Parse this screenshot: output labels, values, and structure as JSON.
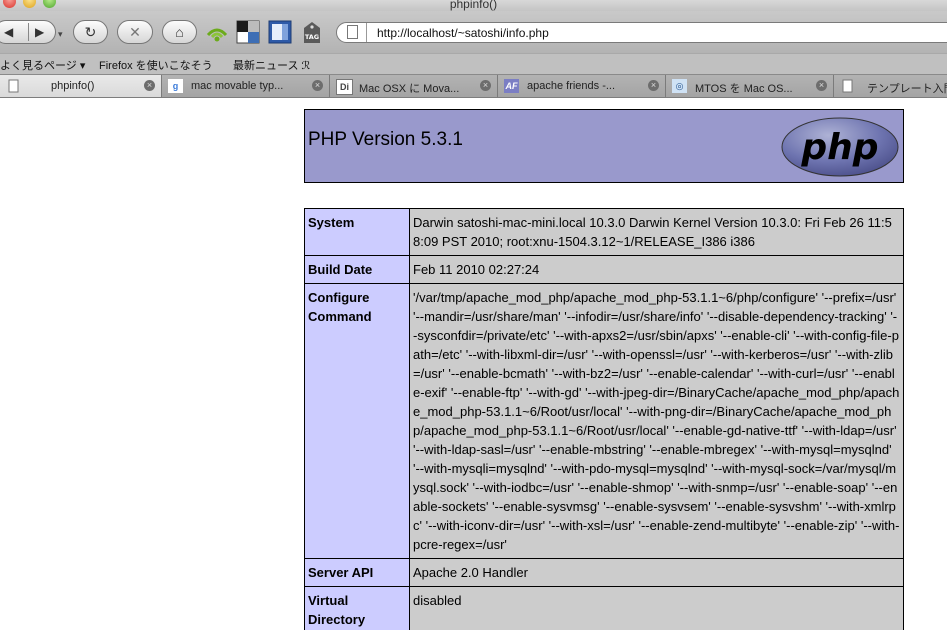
{
  "window": {
    "title": "phpinfo()"
  },
  "toolbar": {
    "back_icon": "back-arrow-icon",
    "forward_icon": "forward-arrow-icon",
    "reload_icon": "reload-icon",
    "stop_icon": "stop-icon",
    "home_icon": "home-icon",
    "url": "http://localhost/~satoshi/info.php"
  },
  "bookmarks": [
    {
      "label": "よく見るページ ▾"
    },
    {
      "label": "Firefox を使いこなそう"
    },
    {
      "label": "最新ニュース ℛ"
    }
  ],
  "tabs": [
    {
      "label": "phpinfo()",
      "active": true
    },
    {
      "label": "mac movable typ...",
      "active": false
    },
    {
      "label": "Mac OSX に Mova...",
      "active": false
    },
    {
      "label": "apache friends -...",
      "active": false
    },
    {
      "label": "MTOS を Mac OS...",
      "active": false
    },
    {
      "label": "テンプレート入門",
      "active": false
    }
  ],
  "page": {
    "version_title": "PHP Version 5.3.1",
    "logo_text": "php",
    "rows": [
      {
        "key": "System",
        "value": "Darwin satoshi-mac-mini.local 10.3.0 Darwin Kernel Version 10.3.0: Fri Feb 26 11:58:09 PST 2010; root:xnu-1504.3.12~1/RELEASE_I386 i386"
      },
      {
        "key": "Build Date",
        "value": "Feb 11 2010 02:27:24"
      },
      {
        "key": "Configure Command",
        "value": "'/var/tmp/apache_mod_php/apache_mod_php-53.1.1~6/php/configure' '--prefix=/usr' '--mandir=/usr/share/man' '--infodir=/usr/share/info' '--disable-dependency-tracking' '--sysconfdir=/private/etc' '--with-apxs2=/usr/sbin/apxs' '--enable-cli' '--with-config-file-path=/etc' '--with-libxml-dir=/usr' '--with-openssl=/usr' '--with-kerberos=/usr' '--with-zlib=/usr' '--enable-bcmath' '--with-bz2=/usr' '--enable-calendar' '--with-curl=/usr' '--enable-exif' '--enable-ftp' '--with-gd' '--with-jpeg-dir=/BinaryCache/apache_mod_php/apache_mod_php-53.1.1~6/Root/usr/local' '--with-png-dir=/BinaryCache/apache_mod_php/apache_mod_php-53.1.1~6/Root/usr/local' '--enable-gd-native-ttf' '--with-ldap=/usr' '--with-ldap-sasl=/usr' '--enable-mbstring' '--enable-mbregex' '--with-mysql=mysqlnd' '--with-mysqli=mysqlnd' '--with-pdo-mysql=mysqlnd' '--with-mysql-sock=/var/mysql/mysql.sock' '--with-iodbc=/usr' '--enable-shmop' '--with-snmp=/usr' '--enable-soap' '--enable-sockets' '--enable-sysvmsg' '--enable-sysvsem' '--enable-sysvshm' '--with-xmlrpc' '--with-iconv-dir=/usr' '--with-xsl=/usr' '--enable-zend-multibyte' '--enable-zip' '--with-pcre-regex=/usr'"
      },
      {
        "key": "Server API",
        "value": "Apache 2.0 Handler"
      },
      {
        "key": "Virtual Directory Support",
        "value": "disabled"
      }
    ]
  },
  "colors": {
    "header_bg": "#9999cc",
    "key_bg": "#ccccff",
    "value_bg": "#cccccc"
  }
}
